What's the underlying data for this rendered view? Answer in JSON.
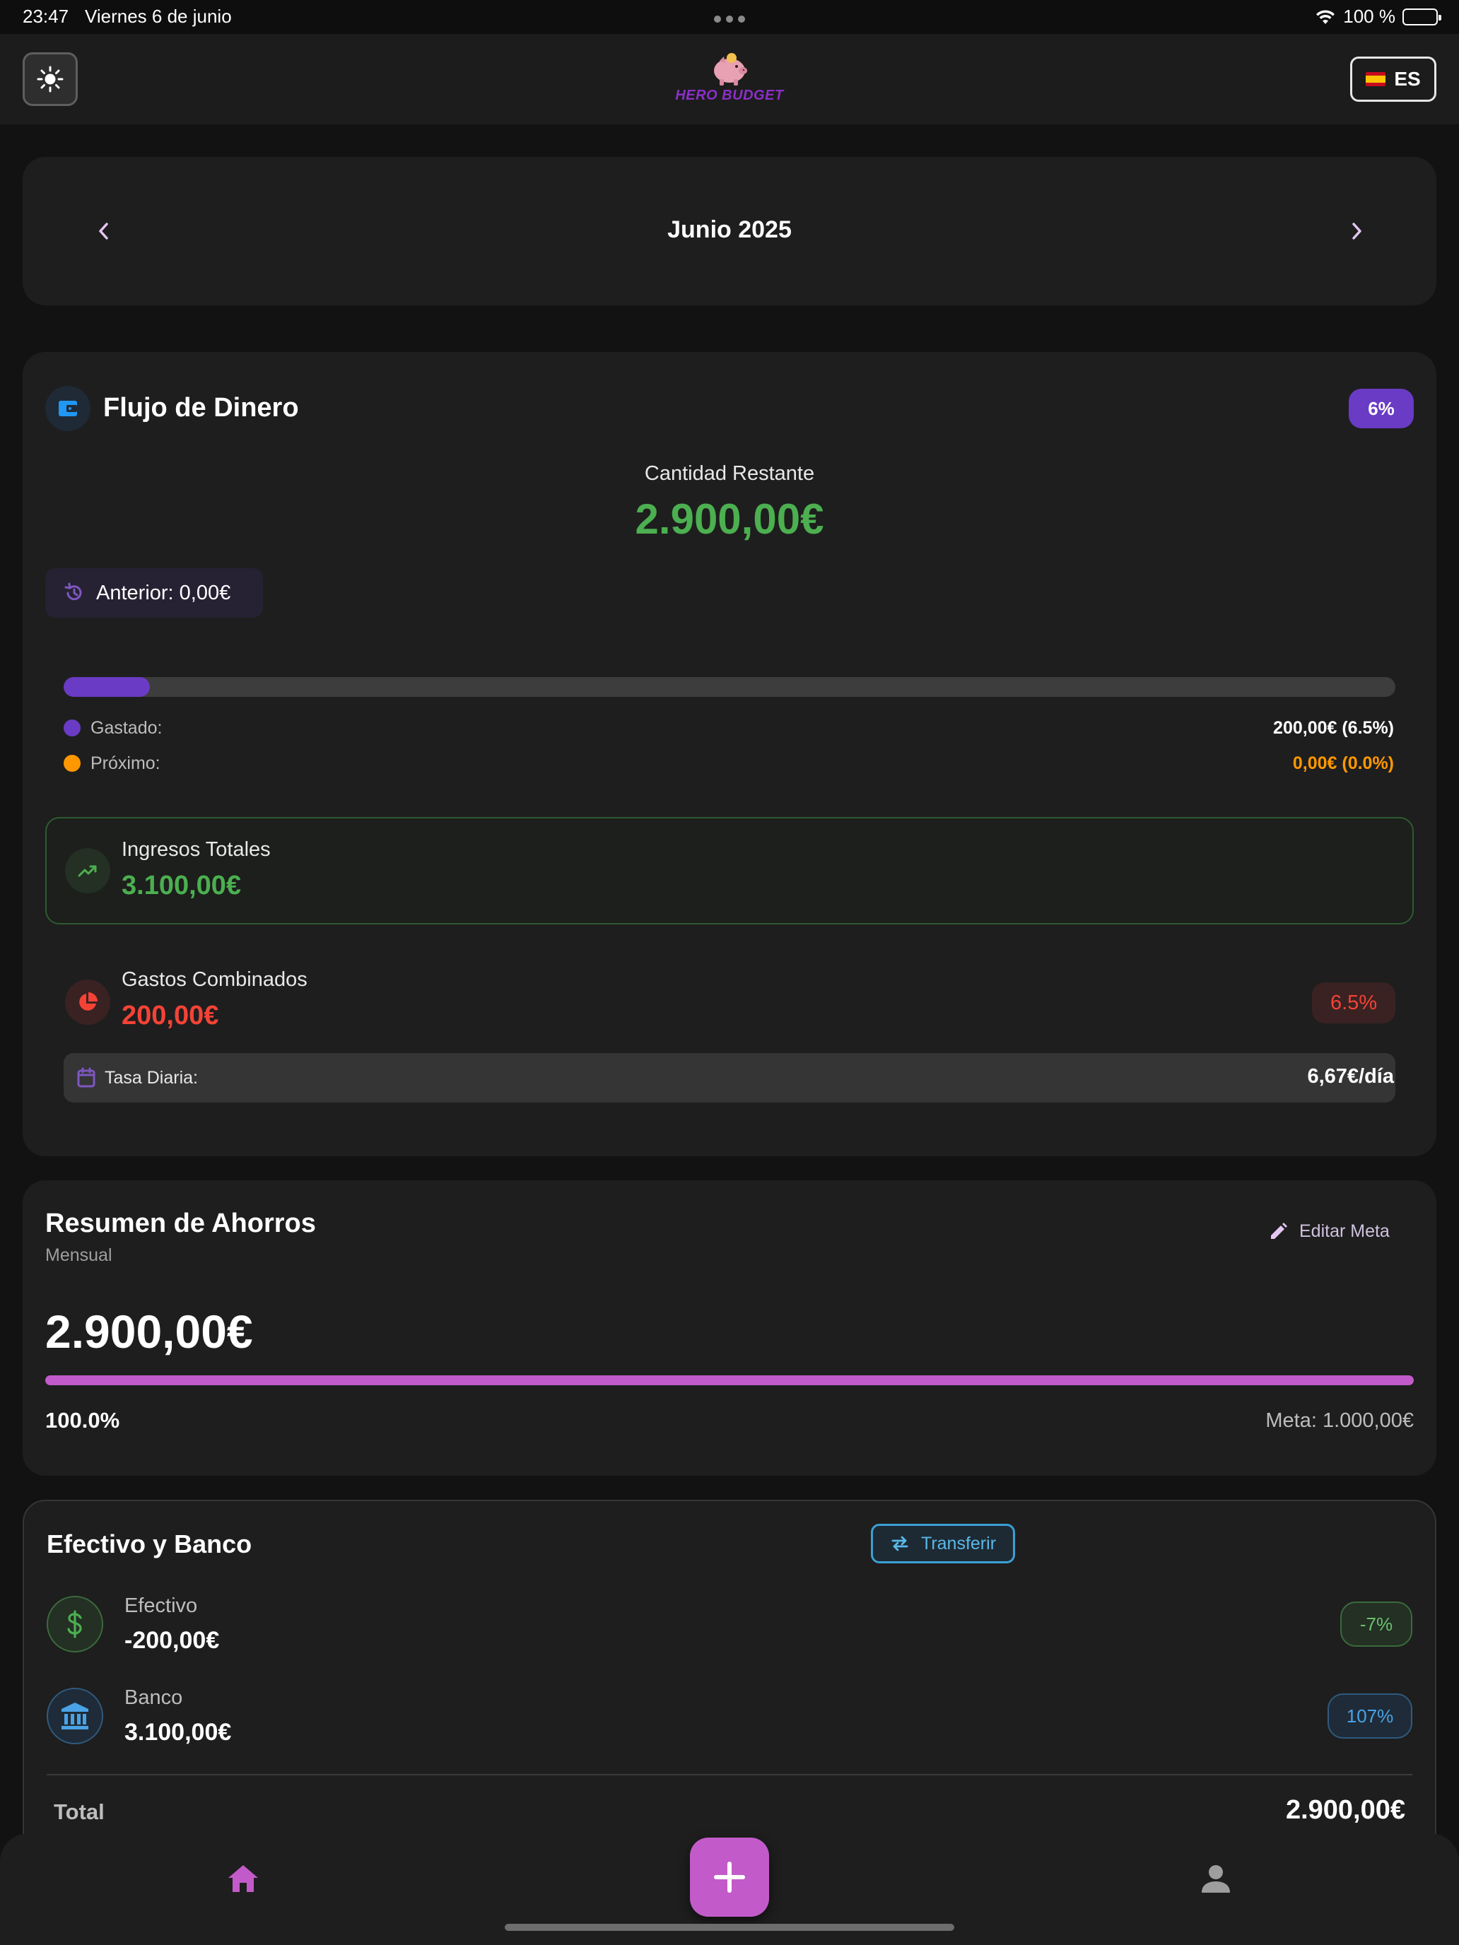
{
  "status_bar": {
    "time": "23:47",
    "date": "Viernes 6 de junio",
    "battery": "100 %"
  },
  "app_bar": {
    "logo_text": "HERO BUDGET",
    "language": "ES"
  },
  "month_selector": {
    "title": "Junio 2025"
  },
  "cash_flow": {
    "title": "Flujo de Dinero",
    "badge": "6%",
    "remaining_label": "Cantidad Restante",
    "remaining_value": "2.900,00€",
    "previous": "Anterior: 0,00€",
    "progress_fraction": 0.065,
    "spent_label": "Gastado:",
    "spent_value": "200,00€ (6.5%)",
    "upcoming_label": "Próximo:",
    "upcoming_value": "0,00€ (0.0%)",
    "income_label": "Ingresos Totales",
    "income_value": "3.100,00€",
    "expenses_label": "Gastos Combinados",
    "expenses_value": "200,00€",
    "expenses_badge": "6.5%",
    "daily_rate_label": "Tasa Diaria:",
    "daily_rate_value": "6,67€/día"
  },
  "savings": {
    "title": "Resumen de Ahorros",
    "subtitle": "Mensual",
    "edit_label": "Editar Meta",
    "value": "2.900,00€",
    "progress_fraction": 1.0,
    "percent": "100.0%",
    "goal": "Meta: 1.000,00€"
  },
  "accounts": {
    "title": "Efectivo y Banco",
    "transfer_label": "Transferir",
    "cash_label": "Efectivo",
    "cash_value": "-200,00€",
    "cash_badge": "-7%",
    "bank_label": "Banco",
    "bank_value": "3.100,00€",
    "bank_badge": "107%",
    "total_label": "Total",
    "total_value": "2.900,00€"
  },
  "colors": {
    "accent_purple": "#6a3bc4",
    "fab_pink": "#c25bc9",
    "income_green": "#4caf50",
    "expense_red": "#f44336",
    "upcoming_orange": "#ff9800",
    "bank_blue": "#4aa3e6"
  },
  "icons": {
    "theme": "sun-icon",
    "prev": "chevron-left-icon",
    "next": "chevron-right-icon",
    "wallet": "wallet-icon",
    "history": "history-icon",
    "income": "trending-up-icon",
    "expenses": "pie-chart-icon",
    "calendar": "calendar-icon",
    "edit": "pencil-icon",
    "transfer": "swap-arrows-icon",
    "cash": "dollar-icon",
    "bank": "bank-icon",
    "home": "home-icon",
    "add": "plus-icon",
    "profile": "person-icon"
  }
}
